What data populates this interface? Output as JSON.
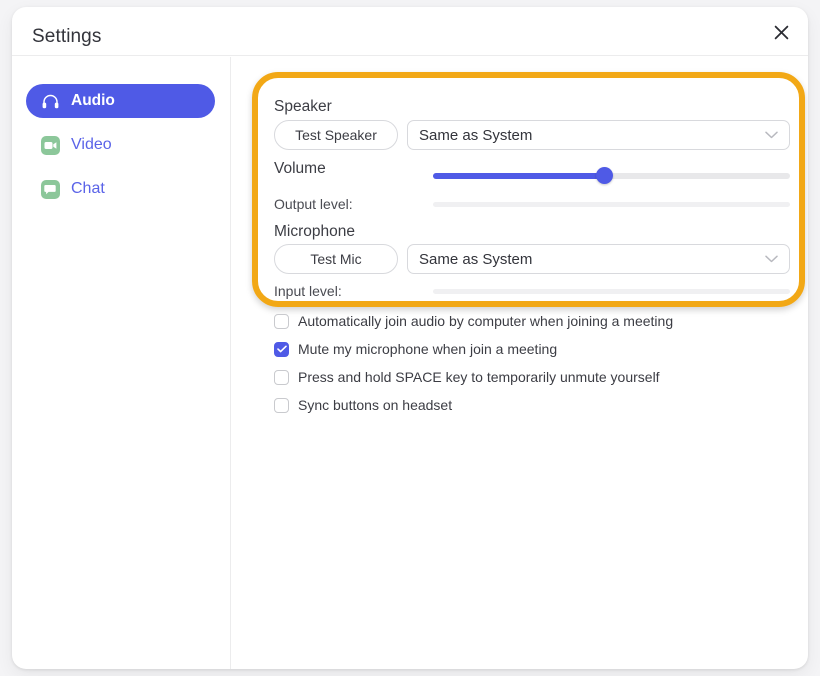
{
  "window": {
    "title": "Settings",
    "close_icon": "close-icon"
  },
  "sidebar": {
    "items": [
      {
        "id": "audio",
        "label": "Audio",
        "icon": "headphones-icon",
        "selected": true
      },
      {
        "id": "video",
        "label": "Video",
        "icon": "video-camera-icon",
        "selected": false
      },
      {
        "id": "chat",
        "label": "Chat",
        "icon": "chat-bubble-icon",
        "selected": false
      }
    ]
  },
  "audio_panel": {
    "speaker": {
      "section_label": "Speaker",
      "test_button_label": "Test Speaker",
      "device_value": "Same as System",
      "chevron_icon": "chevron-down-icon"
    },
    "volume": {
      "label": "Volume",
      "percent": 48
    },
    "output_level": {
      "label": "Output level:",
      "percent": 0
    },
    "microphone": {
      "section_label": "Microphone",
      "test_button_label": "Test Mic",
      "device_value": "Same as System",
      "chevron_icon": "chevron-down-icon"
    },
    "input_level": {
      "label": "Input level:",
      "percent": 0
    },
    "options": [
      {
        "label": "Automatically join audio by computer when joining a meeting",
        "checked": false
      },
      {
        "label": "Mute my microphone when join a meeting",
        "checked": true
      },
      {
        "label": "Press and hold SPACE key to temporarily unmute yourself",
        "checked": false
      },
      {
        "label": "Sync buttons on headset",
        "checked": false
      }
    ]
  },
  "annotation": {
    "highlight_color": "#f2a816"
  },
  "colors": {
    "accent_blue": "#4f5ae6",
    "nav_link_blue": "#5a63e8",
    "icon_green": "#8cc79a",
    "window_bg": "#ffffff",
    "page_bg": "#f4f4f6"
  }
}
